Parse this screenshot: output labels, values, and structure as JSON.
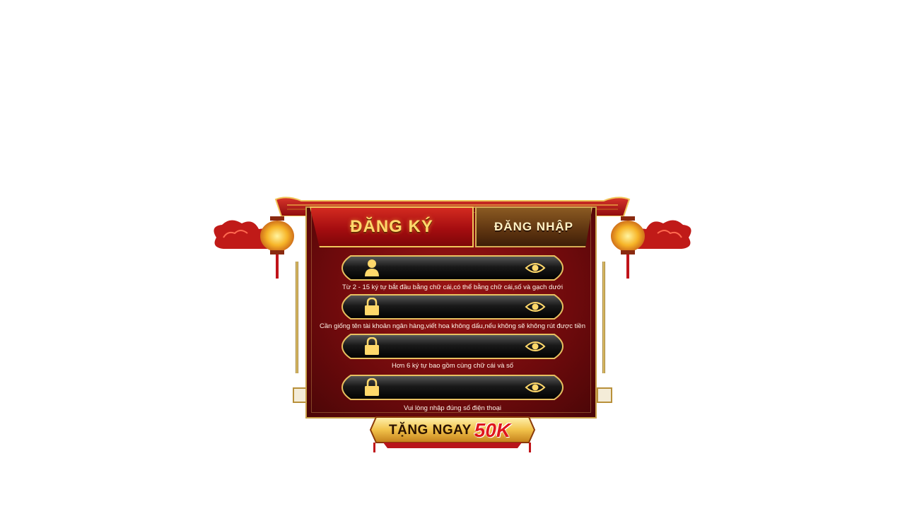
{
  "tabs": {
    "register": "ĐĂNG KÝ",
    "login": "ĐĂNG NHẬP",
    "active": "register"
  },
  "fields": [
    {
      "id": "username",
      "icon": "user-icon",
      "value": "",
      "hint": "Từ 2 - 15 ký tự bắt đầu bằng chữ cái,có thể bằng chữ cái,số và gạch dưới"
    },
    {
      "id": "fullname",
      "icon": "lock-icon",
      "value": "",
      "hint": "Cần giống tên tài khoản ngân hàng,viết hoa không dấu,nếu không sẽ không rút được tiền"
    },
    {
      "id": "password",
      "icon": "lock-icon",
      "value": "",
      "hint": "Hơn 6 ký tự bao gồm cùng chữ cái và số"
    },
    {
      "id": "phone",
      "icon": "lock-icon",
      "value": "",
      "hint": "Vui lòng nhập đúng số điện thoại"
    }
  ],
  "bonus": {
    "label": "TẶNG NGAY",
    "amount": "50K"
  },
  "colors": {
    "panel_red": "#8a0f12",
    "gold": "#f1c65a",
    "bonus_red": "#e0161c"
  }
}
